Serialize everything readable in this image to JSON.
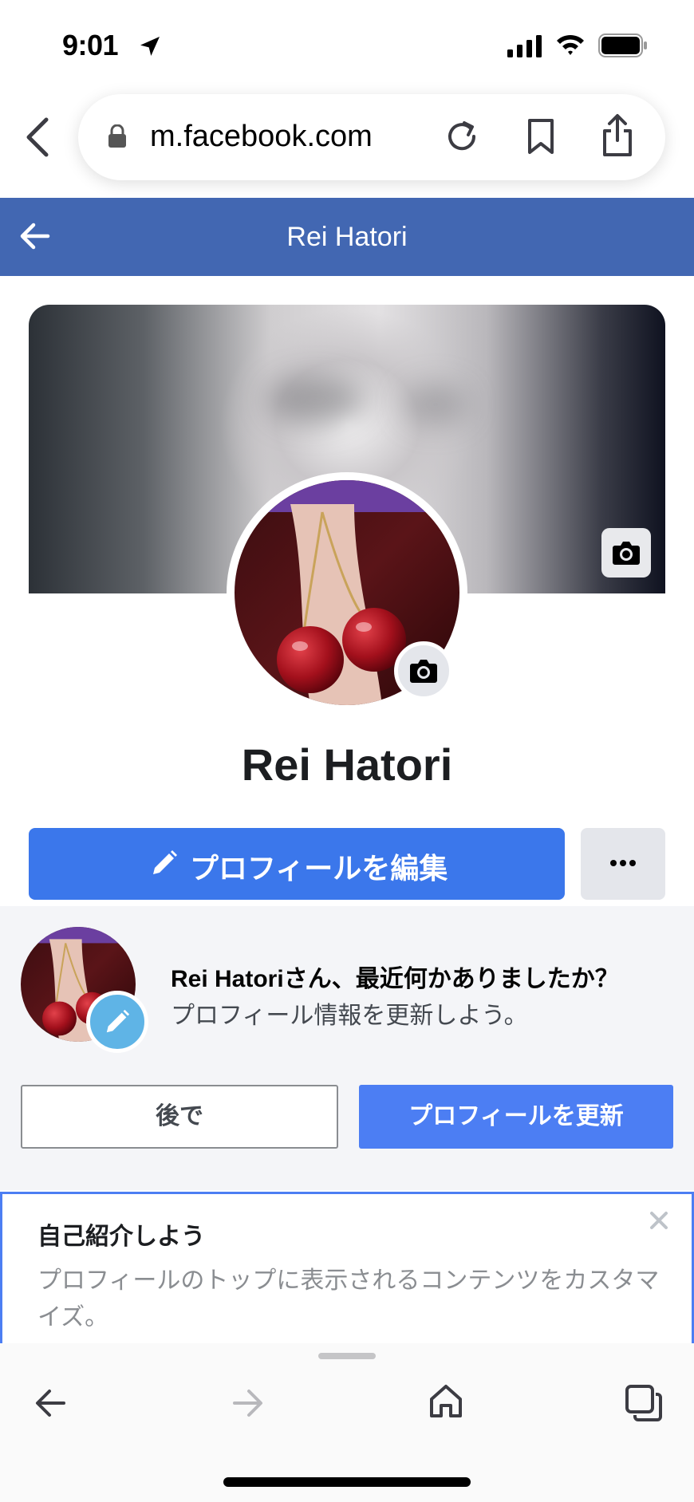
{
  "status_bar": {
    "time": "9:01"
  },
  "browser": {
    "url": "m.facebook.com"
  },
  "header": {
    "title": "Rei Hatori"
  },
  "profile": {
    "name": "Rei Hatori",
    "edit_label": "プロフィールを編集"
  },
  "prompt": {
    "title": "Rei Hatoriさん、最近何かありましたか？",
    "subtitle": "プロフィール情報を更新しよう。",
    "later_label": "後で",
    "update_label": "プロフィールを更新"
  },
  "intro": {
    "title": "自己紹介しよう",
    "description": "プロフィールのトップに表示されるコンテンツをカスタマイズ。"
  },
  "colors": {
    "fb_header": "#4267b2",
    "primary_button": "#3b77eb",
    "update_button": "#4c7ef3"
  }
}
